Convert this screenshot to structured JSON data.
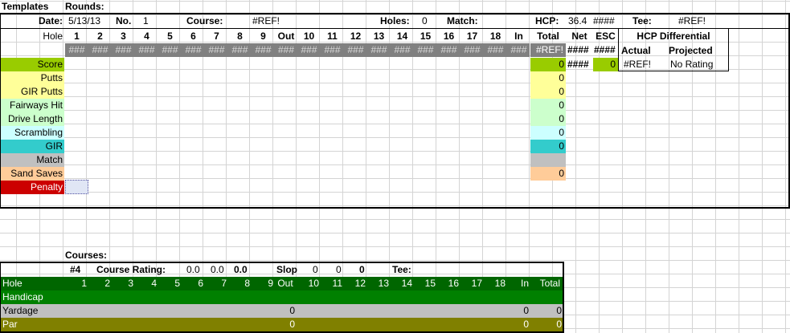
{
  "top": {
    "templates_label": "Templates",
    "rounds_label": "Rounds:",
    "date_label": "Date:",
    "date_value": "5/13/13",
    "no_label": "No.",
    "no_value": "1",
    "course_label": "Course:",
    "course_value": "#REF!",
    "holes_label": "Holes:",
    "holes_value": "0",
    "match_label": "Match:",
    "hcp_label": "HCP:",
    "hcp_value": "36.4",
    "hcp_hash": "####",
    "tee_label": "Tee:",
    "tee_value": "#REF!"
  },
  "scorecard": {
    "hole_label": "Hole",
    "holes": [
      "1",
      "2",
      "3",
      "4",
      "5",
      "6",
      "7",
      "8",
      "9",
      "Out",
      "10",
      "11",
      "12",
      "13",
      "14",
      "15",
      "16",
      "17",
      "18",
      "In",
      "Total",
      "Net",
      "ESC"
    ],
    "hash_cells": [
      "###",
      "###",
      "###",
      "###",
      "###",
      "###",
      "###",
      "###",
      "###",
      "###",
      "###",
      "###",
      "###",
      "###",
      "###",
      "###",
      "###",
      "###",
      "###",
      "###"
    ],
    "total_ref": "#REF!",
    "net_hash": "####",
    "esc_hash": "####",
    "rows": [
      {
        "label": "Score",
        "total": "0",
        "net": "####",
        "esc": "0"
      },
      {
        "label": "Putts",
        "total": "0"
      },
      {
        "label": "GIR Putts",
        "total": "0"
      },
      {
        "label": "Fairways Hit",
        "total": "0"
      },
      {
        "label": "Drive Length",
        "total": "0"
      },
      {
        "label": "Scrambling",
        "total": "0"
      },
      {
        "label": "GIR",
        "total": "0"
      },
      {
        "label": "Match",
        "total": ""
      },
      {
        "label": "Sand Saves",
        "total": "0"
      },
      {
        "label": "Penalty",
        "total": ""
      }
    ],
    "hcp_diff": {
      "title": "HCP Differential",
      "actual_label": "Actual",
      "projected_label": "Projected",
      "actual_value": "#REF!",
      "projected_value": "No Rating"
    }
  },
  "courses": {
    "title": "Courses:",
    "number": "#4",
    "rating_label": "Course Rating:",
    "rating_values": [
      "0.0",
      "0.0",
      "0.0"
    ],
    "slope_label": "Slop",
    "slope_values": [
      "0",
      "0",
      "0"
    ],
    "tee_label": "Tee:",
    "hole_label": "Hole",
    "holes": [
      "1",
      "2",
      "3",
      "4",
      "5",
      "6",
      "7",
      "8",
      "9",
      "Out",
      "10",
      "11",
      "12",
      "13",
      "14",
      "15",
      "16",
      "17",
      "18",
      "In",
      "Total"
    ],
    "handicap_label": "Handicap",
    "yardage_label": "Yardage",
    "yardage_out": "0",
    "yardage_in": "0",
    "yardage_total": "0",
    "par_label": "Par",
    "par_out": "0",
    "par_in": "0",
    "par_total": "0"
  },
  "colors": {
    "score": "#99cc00",
    "putts": "#ffff99",
    "fairways": "#ccffcc",
    "scrambling": "#ccffff",
    "gir": "#33cccc",
    "match": "#c0c0c0",
    "sand": "#ffcc99",
    "penalty": "#cc0000",
    "hash_band": "#808080",
    "course_header": "#006600",
    "handicap": "#008000",
    "yardage": "#c0c0c0",
    "par": "#808000"
  }
}
